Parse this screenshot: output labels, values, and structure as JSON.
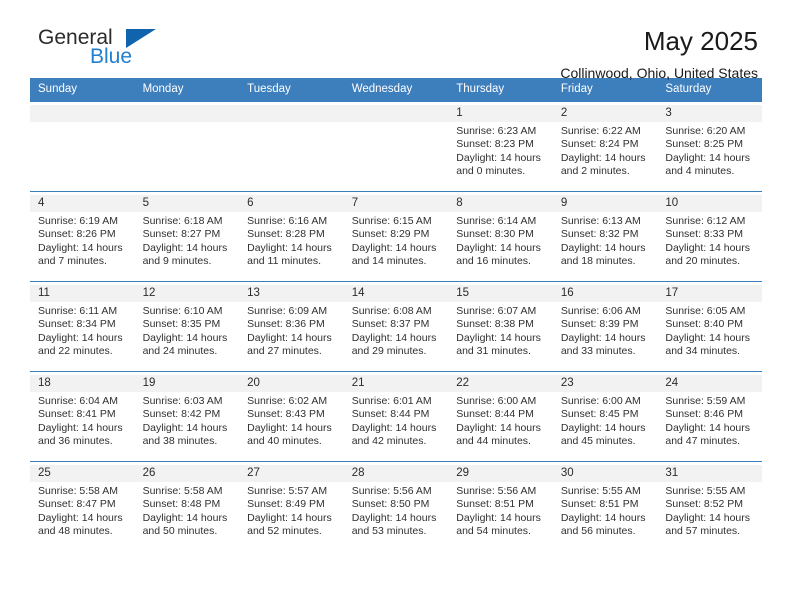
{
  "brand": {
    "word_one": "General",
    "word_two": "Blue",
    "triangle_icon": "brand-triangle-icon"
  },
  "header": {
    "title": "May 2025",
    "subtitle": "Collinwood, Ohio, United States"
  },
  "colors": {
    "header_blue": "#3d7ebd",
    "brand_dark_blue": "#1064ad",
    "brand_light_blue": "#1f7fd0",
    "day_number_bar": "#f2f2f2",
    "text": "#303030"
  },
  "weekday_headers": [
    "Sunday",
    "Monday",
    "Tuesday",
    "Wednesday",
    "Thursday",
    "Friday",
    "Saturday"
  ],
  "weeks": [
    [
      {
        "day": "",
        "lines": [
          "",
          "",
          "",
          ""
        ]
      },
      {
        "day": "",
        "lines": [
          "",
          "",
          "",
          ""
        ]
      },
      {
        "day": "",
        "lines": [
          "",
          "",
          "",
          ""
        ]
      },
      {
        "day": "",
        "lines": [
          "",
          "",
          "",
          ""
        ]
      },
      {
        "day": "1",
        "lines": [
          "Sunrise: 6:23 AM",
          "Sunset: 8:23 PM",
          "Daylight: 14 hours",
          "and 0 minutes."
        ]
      },
      {
        "day": "2",
        "lines": [
          "Sunrise: 6:22 AM",
          "Sunset: 8:24 PM",
          "Daylight: 14 hours",
          "and 2 minutes."
        ]
      },
      {
        "day": "3",
        "lines": [
          "Sunrise: 6:20 AM",
          "Sunset: 8:25 PM",
          "Daylight: 14 hours",
          "and 4 minutes."
        ]
      }
    ],
    [
      {
        "day": "4",
        "lines": [
          "Sunrise: 6:19 AM",
          "Sunset: 8:26 PM",
          "Daylight: 14 hours",
          "and 7 minutes."
        ]
      },
      {
        "day": "5",
        "lines": [
          "Sunrise: 6:18 AM",
          "Sunset: 8:27 PM",
          "Daylight: 14 hours",
          "and 9 minutes."
        ]
      },
      {
        "day": "6",
        "lines": [
          "Sunrise: 6:16 AM",
          "Sunset: 8:28 PM",
          "Daylight: 14 hours",
          "and 11 minutes."
        ]
      },
      {
        "day": "7",
        "lines": [
          "Sunrise: 6:15 AM",
          "Sunset: 8:29 PM",
          "Daylight: 14 hours",
          "and 14 minutes."
        ]
      },
      {
        "day": "8",
        "lines": [
          "Sunrise: 6:14 AM",
          "Sunset: 8:30 PM",
          "Daylight: 14 hours",
          "and 16 minutes."
        ]
      },
      {
        "day": "9",
        "lines": [
          "Sunrise: 6:13 AM",
          "Sunset: 8:32 PM",
          "Daylight: 14 hours",
          "and 18 minutes."
        ]
      },
      {
        "day": "10",
        "lines": [
          "Sunrise: 6:12 AM",
          "Sunset: 8:33 PM",
          "Daylight: 14 hours",
          "and 20 minutes."
        ]
      }
    ],
    [
      {
        "day": "11",
        "lines": [
          "Sunrise: 6:11 AM",
          "Sunset: 8:34 PM",
          "Daylight: 14 hours",
          "and 22 minutes."
        ]
      },
      {
        "day": "12",
        "lines": [
          "Sunrise: 6:10 AM",
          "Sunset: 8:35 PM",
          "Daylight: 14 hours",
          "and 24 minutes."
        ]
      },
      {
        "day": "13",
        "lines": [
          "Sunrise: 6:09 AM",
          "Sunset: 8:36 PM",
          "Daylight: 14 hours",
          "and 27 minutes."
        ]
      },
      {
        "day": "14",
        "lines": [
          "Sunrise: 6:08 AM",
          "Sunset: 8:37 PM",
          "Daylight: 14 hours",
          "and 29 minutes."
        ]
      },
      {
        "day": "15",
        "lines": [
          "Sunrise: 6:07 AM",
          "Sunset: 8:38 PM",
          "Daylight: 14 hours",
          "and 31 minutes."
        ]
      },
      {
        "day": "16",
        "lines": [
          "Sunrise: 6:06 AM",
          "Sunset: 8:39 PM",
          "Daylight: 14 hours",
          "and 33 minutes."
        ]
      },
      {
        "day": "17",
        "lines": [
          "Sunrise: 6:05 AM",
          "Sunset: 8:40 PM",
          "Daylight: 14 hours",
          "and 34 minutes."
        ]
      }
    ],
    [
      {
        "day": "18",
        "lines": [
          "Sunrise: 6:04 AM",
          "Sunset: 8:41 PM",
          "Daylight: 14 hours",
          "and 36 minutes."
        ]
      },
      {
        "day": "19",
        "lines": [
          "Sunrise: 6:03 AM",
          "Sunset: 8:42 PM",
          "Daylight: 14 hours",
          "and 38 minutes."
        ]
      },
      {
        "day": "20",
        "lines": [
          "Sunrise: 6:02 AM",
          "Sunset: 8:43 PM",
          "Daylight: 14 hours",
          "and 40 minutes."
        ]
      },
      {
        "day": "21",
        "lines": [
          "Sunrise: 6:01 AM",
          "Sunset: 8:44 PM",
          "Daylight: 14 hours",
          "and 42 minutes."
        ]
      },
      {
        "day": "22",
        "lines": [
          "Sunrise: 6:00 AM",
          "Sunset: 8:44 PM",
          "Daylight: 14 hours",
          "and 44 minutes."
        ]
      },
      {
        "day": "23",
        "lines": [
          "Sunrise: 6:00 AM",
          "Sunset: 8:45 PM",
          "Daylight: 14 hours",
          "and 45 minutes."
        ]
      },
      {
        "day": "24",
        "lines": [
          "Sunrise: 5:59 AM",
          "Sunset: 8:46 PM",
          "Daylight: 14 hours",
          "and 47 minutes."
        ]
      }
    ],
    [
      {
        "day": "25",
        "lines": [
          "Sunrise: 5:58 AM",
          "Sunset: 8:47 PM",
          "Daylight: 14 hours",
          "and 48 minutes."
        ]
      },
      {
        "day": "26",
        "lines": [
          "Sunrise: 5:58 AM",
          "Sunset: 8:48 PM",
          "Daylight: 14 hours",
          "and 50 minutes."
        ]
      },
      {
        "day": "27",
        "lines": [
          "Sunrise: 5:57 AM",
          "Sunset: 8:49 PM",
          "Daylight: 14 hours",
          "and 52 minutes."
        ]
      },
      {
        "day": "28",
        "lines": [
          "Sunrise: 5:56 AM",
          "Sunset: 8:50 PM",
          "Daylight: 14 hours",
          "and 53 minutes."
        ]
      },
      {
        "day": "29",
        "lines": [
          "Sunrise: 5:56 AM",
          "Sunset: 8:51 PM",
          "Daylight: 14 hours",
          "and 54 minutes."
        ]
      },
      {
        "day": "30",
        "lines": [
          "Sunrise: 5:55 AM",
          "Sunset: 8:51 PM",
          "Daylight: 14 hours",
          "and 56 minutes."
        ]
      },
      {
        "day": "31",
        "lines": [
          "Sunrise: 5:55 AM",
          "Sunset: 8:52 PM",
          "Daylight: 14 hours",
          "and 57 minutes."
        ]
      }
    ]
  ]
}
